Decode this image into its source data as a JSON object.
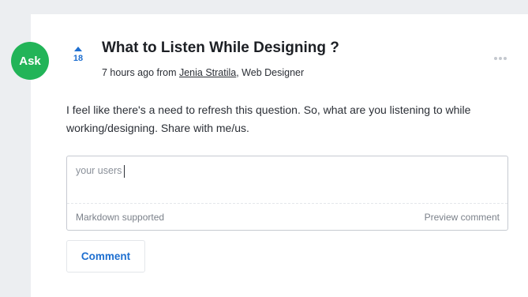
{
  "badge": {
    "label": "Ask",
    "color": "#22b458"
  },
  "vote": {
    "count": "18",
    "accent": "#1e6fd0",
    "arrow_icon": "upvote-arrow-icon"
  },
  "post": {
    "title": "What to Listen While Designing ?",
    "time_prefix": "7 hours ago from ",
    "author": "Jenia Stratila",
    "author_role": ", Web Designer",
    "body": "I feel like there's a need to refresh this question. So, what are you listening to while working/designing. Share with me/us.",
    "more_icon": "more-options-icon"
  },
  "comment": {
    "placeholder": "your users",
    "value": "",
    "markdown_hint": "Markdown supported",
    "preview_label": "Preview comment",
    "submit_label": "Comment"
  }
}
